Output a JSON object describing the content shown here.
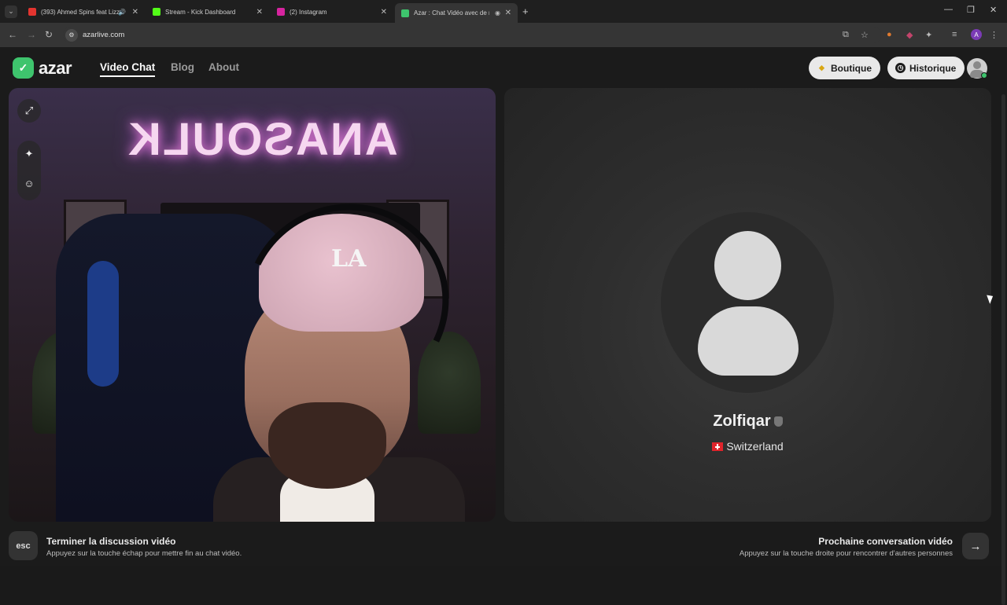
{
  "browser": {
    "tabs": [
      {
        "title": "(393) Ahmed Spins feat Lizz",
        "favicon_color": "#e3342f",
        "active": false
      },
      {
        "title": "Stream - Kick Dashboard",
        "favicon_color": "#53fc18",
        "active": false
      },
      {
        "title": "(2) Instagram",
        "favicon_color": "#d6249f",
        "active": false
      },
      {
        "title": "Azar : Chat Vidéo avec de n",
        "favicon_color": "#3ec46d",
        "active": true
      }
    ],
    "new_tab_icon": "+",
    "url": "azarlive.com",
    "profile_initial": "A"
  },
  "header": {
    "logo_text": "azar",
    "nav": [
      {
        "label": "Video Chat",
        "active": true
      },
      {
        "label": "Blog",
        "active": false
      },
      {
        "label": "About",
        "active": false
      }
    ],
    "boutique_label": "Boutique",
    "historique_label": "Historique"
  },
  "local_video": {
    "neon_sign": "ANASOULK",
    "cap_logo": "LA"
  },
  "peer": {
    "name": "Zolfiqar",
    "country": "Switzerland"
  },
  "footer": {
    "esc_key": "esc",
    "end_title": "Terminer la discussion vidéo",
    "end_sub": "Appuyez sur la touche échap pour mettre fin au chat vidéo.",
    "next_title": "Prochaine conversation vidéo",
    "next_sub": "Appuyez sur la touche droite pour rencontrer d'autres personnes"
  },
  "colors": {
    "brand": "#3ec46d",
    "background": "#1b1b1b",
    "pill": "#e9e9e9"
  }
}
